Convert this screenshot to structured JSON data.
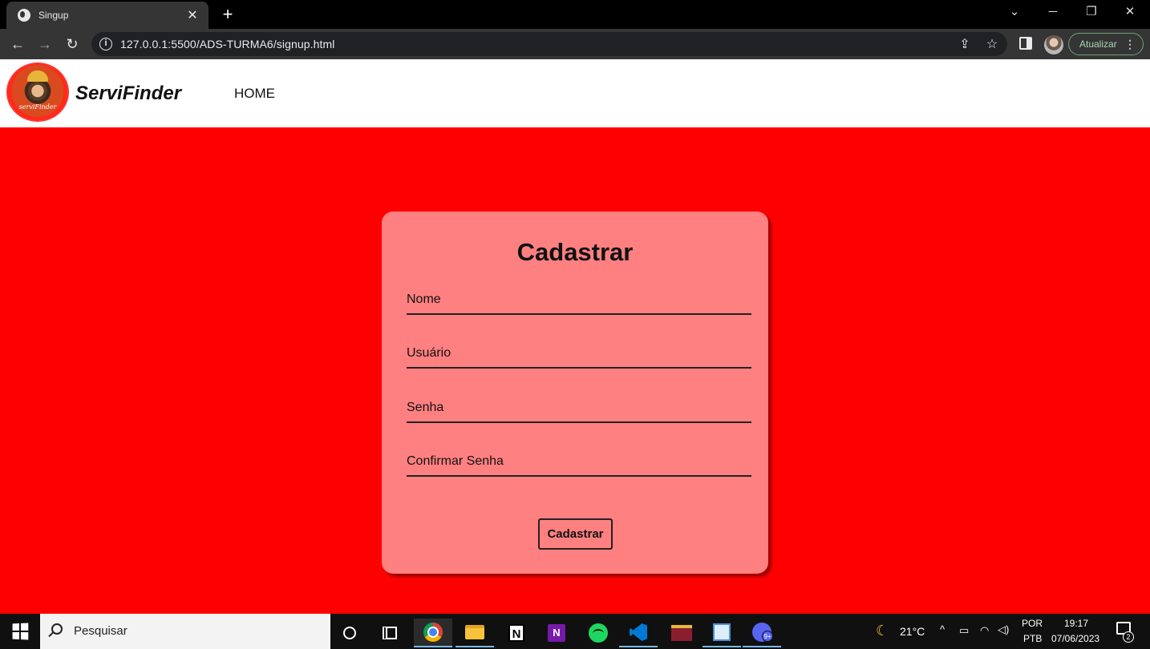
{
  "browser": {
    "tab_title": "Singup",
    "url": "127.0.0.1:5500/ADS-TURMA6/signup.html",
    "update_label": "Atualizar"
  },
  "site": {
    "logo_text": "serviFinder",
    "brand": "ServiFinder",
    "nav": {
      "home": "HOME"
    }
  },
  "form": {
    "title": "Cadastrar",
    "fields": {
      "nome": "Nome",
      "usuario": "Usuário",
      "senha": "Senha",
      "confirmar": "Confirmar Senha"
    },
    "submit_label": "Cadastrar"
  },
  "taskbar": {
    "search_placeholder": "Pesquisar",
    "temperature": "21°C",
    "lang_top": "POR",
    "lang_bottom": "PTB",
    "time": "19:17",
    "date": "07/06/2023",
    "discord_badge": "9+",
    "notification_count": "2"
  },
  "colors": {
    "page_background": "#ff0000",
    "card_background": "#ff8080",
    "header_background": "#ffffff"
  },
  "icons": [
    "globe-icon",
    "close-icon",
    "plus-icon",
    "back-icon",
    "forward-icon",
    "reload-icon",
    "info-icon",
    "share-icon",
    "star-icon",
    "sidepanel-icon",
    "windows-icon",
    "search-icon",
    "cortana-icon",
    "taskview-icon",
    "chrome-icon",
    "folder-icon",
    "notion-icon",
    "onenote-icon",
    "spotify-icon",
    "vscode-icon",
    "winrar-icon",
    "paint-icon",
    "discord-icon",
    "moon-icon",
    "notification-icon"
  ]
}
